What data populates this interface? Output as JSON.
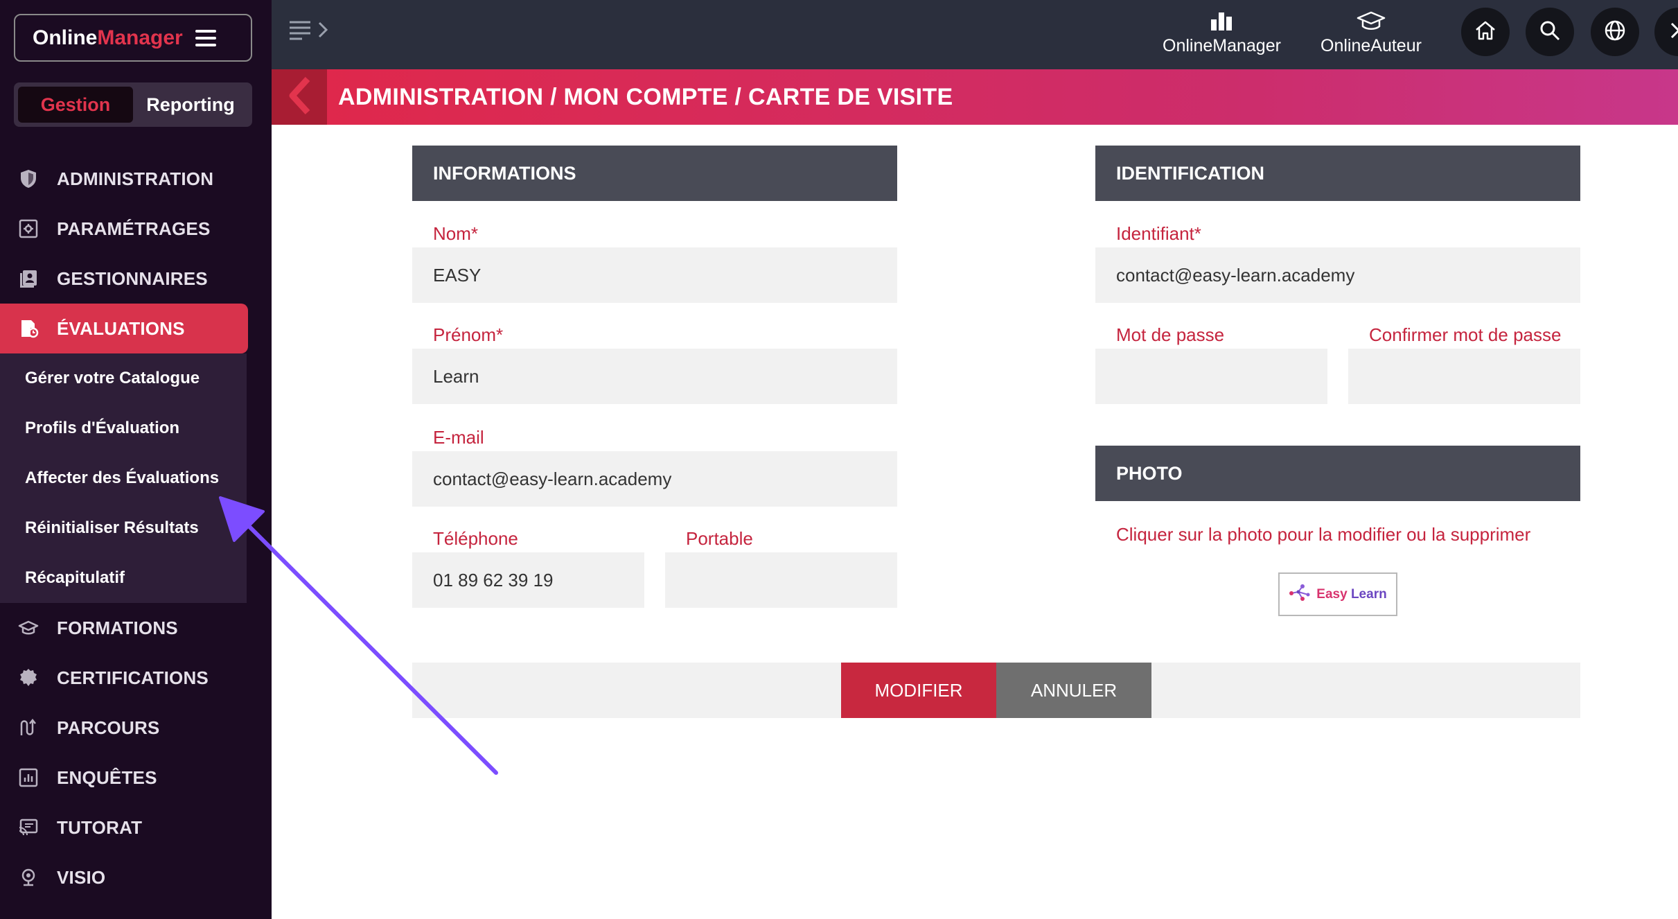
{
  "brand": {
    "part1": "Online",
    "part2": "Manager"
  },
  "mode_switch": {
    "gestion": "Gestion",
    "reporting": "Reporting"
  },
  "sidebar": {
    "items": [
      {
        "label": "ADMINISTRATION",
        "icon": "shield-icon"
      },
      {
        "label": "PARAMÉTRAGES",
        "icon": "settings-icon"
      },
      {
        "label": "GESTIONNAIRES",
        "icon": "users-book-icon"
      },
      {
        "label": "ÉVALUATIONS",
        "icon": "evaluation-icon",
        "active": true
      },
      {
        "label": "FORMATIONS",
        "icon": "graduation-cap-icon"
      },
      {
        "label": "CERTIFICATIONS",
        "icon": "badge-icon"
      },
      {
        "label": "PARCOURS",
        "icon": "path-icon"
      },
      {
        "label": "ENQUÊTES",
        "icon": "chart-survey-icon"
      },
      {
        "label": "TUTORAT",
        "icon": "screen-cast-icon"
      },
      {
        "label": "VISIO",
        "icon": "webcam-icon"
      }
    ],
    "submenu": [
      "Gérer votre Catalogue",
      "Profils d'Évaluation",
      "Affecter des Évaluations",
      "Réinitialiser Résultats",
      "Récapitulatif"
    ]
  },
  "topbar": {
    "apps": [
      {
        "label": "OnlineManager",
        "icon": "bar-chart-icon"
      },
      {
        "label": "OnlineAuteur",
        "icon": "graduation-cap-icon"
      }
    ],
    "buttons": [
      "home-icon",
      "search-icon",
      "globe-icon",
      "close-icon"
    ]
  },
  "page": {
    "title": "ADMINISTRATION / MON COMPTE / CARTE DE VISITE"
  },
  "informations": {
    "header": "INFORMATIONS",
    "nom_label": "Nom*",
    "nom_value": "EASY",
    "prenom_label": "Prénom*",
    "prenom_value": "Learn",
    "email_label": "E-mail",
    "email_value": "contact@easy-learn.academy",
    "telephone_label": "Téléphone",
    "telephone_value": "01 89 62 39 19",
    "portable_label": "Portable",
    "portable_value": ""
  },
  "identification": {
    "header": "IDENTIFICATION",
    "identifiant_label": "Identifiant*",
    "identifiant_value": "contact@easy-learn.academy",
    "password_label": "Mot de passe",
    "password_value": "",
    "confirm_label": "Confirmer mot de passe",
    "confirm_value": ""
  },
  "photo": {
    "header": "PHOTO",
    "hint": "Cliquer sur la photo pour la modifier ou la supprimer",
    "logo_part1": "Easy",
    "logo_part2": "Learn"
  },
  "actions": {
    "modify": "MODIFIER",
    "cancel": "ANNULER"
  },
  "colors": {
    "accent": "#d8334c",
    "sidebar_bg": "#1b0b22",
    "topbar_bg": "#2b2f3d",
    "annotation_arrow": "#7c4dff"
  }
}
